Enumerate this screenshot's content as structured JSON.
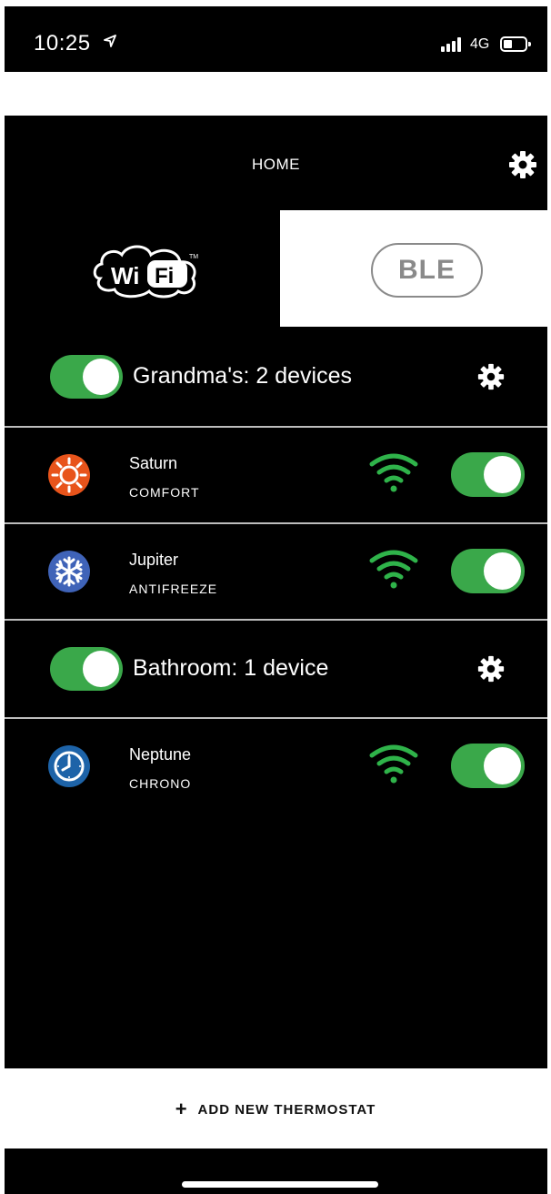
{
  "status_bar": {
    "time": "10:25",
    "location_icon": "location-arrow-icon",
    "network": "4G",
    "signal_icon": "cellular-signal-icon",
    "battery_icon": "battery-low-icon"
  },
  "header": {
    "title": "HOME",
    "settings_icon": "gear-icon"
  },
  "connection_tabs": {
    "wifi": {
      "label": "WiFi",
      "selected": false
    },
    "ble": {
      "label": "BLE",
      "selected": true
    }
  },
  "groups": [
    {
      "label": "Grandma's: 2 devices",
      "enabled": true,
      "devices": [
        {
          "name": "Saturn",
          "mode": "COMFORT",
          "mode_icon": "sun-icon",
          "icon_color": "#e8541b",
          "enabled": true
        },
        {
          "name": "Jupiter",
          "mode": "ANTIFREEZE",
          "mode_icon": "snowflake-icon",
          "icon_color": "#3f63b8",
          "enabled": true
        }
      ]
    },
    {
      "label": "Bathroom: 1 device",
      "enabled": true,
      "devices": [
        {
          "name": "Neptune",
          "mode": "CHRONO",
          "mode_icon": "clock-icon",
          "icon_color": "#1d63a8",
          "enabled": true
        }
      ]
    }
  ],
  "add_thermostat": {
    "label": "ADD NEW THERMOSTAT",
    "icon": "plus-icon"
  },
  "colors": {
    "accent_green": "#3aa84a",
    "wifi_signal": "#2fb34a",
    "background": "#000000"
  }
}
